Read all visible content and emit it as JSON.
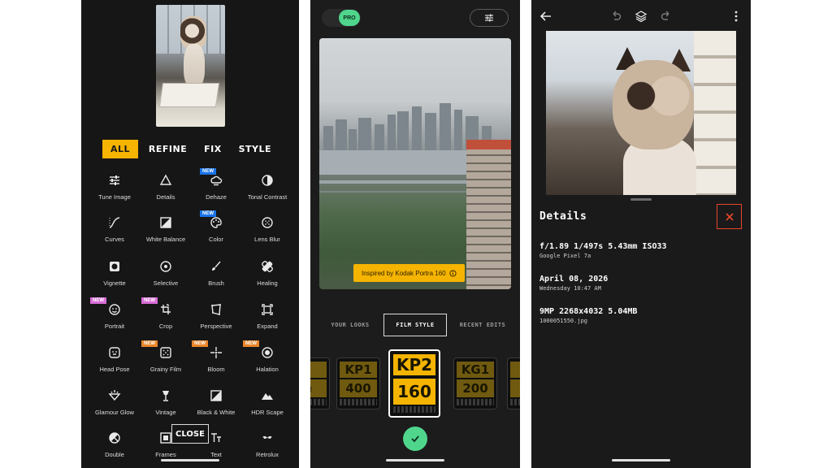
{
  "editor": {
    "tabs": [
      "ALL",
      "REFINE",
      "FIX",
      "STYLE"
    ],
    "active_tab": "ALL",
    "tools": [
      {
        "label": "Tune Image",
        "icon": "sliders-icon"
      },
      {
        "label": "Details",
        "icon": "triangle-icon"
      },
      {
        "label": "Dehaze",
        "icon": "cloud-icon",
        "badge": "NEW"
      },
      {
        "label": "Tonal Contrast",
        "icon": "half-circle-icon"
      },
      {
        "label": "Curves",
        "icon": "curves-icon"
      },
      {
        "label": "White Balance",
        "icon": "white-balance-icon"
      },
      {
        "label": "Color",
        "icon": "palette-icon",
        "badge": "NEW"
      },
      {
        "label": "Lens Blur",
        "icon": "lens-blur-icon"
      },
      {
        "label": "Vignette",
        "icon": "vignette-icon"
      },
      {
        "label": "Selective",
        "icon": "target-icon"
      },
      {
        "label": "Brush",
        "icon": "brush-icon"
      },
      {
        "label": "Healing",
        "icon": "bandage-icon"
      },
      {
        "label": "Portrait",
        "icon": "face-icon",
        "badge": "NEW"
      },
      {
        "label": "Crop",
        "icon": "crop-rotate-icon",
        "badge": "NEW"
      },
      {
        "label": "Perspective",
        "icon": "perspective-icon"
      },
      {
        "label": "Expand",
        "icon": "expand-icon"
      },
      {
        "label": "Head Pose",
        "icon": "head-pose-icon"
      },
      {
        "label": "Grainy Film",
        "icon": "grain-icon",
        "badge": "NEW"
      },
      {
        "label": "Bloom",
        "icon": "sparkle-icon",
        "badge": "NEW"
      },
      {
        "label": "Halation",
        "icon": "halation-icon",
        "badge": "NEW"
      },
      {
        "label": "Glamour Glow",
        "icon": "glow-icon"
      },
      {
        "label": "Vintage",
        "icon": "lamp-icon"
      },
      {
        "label": "Black & White",
        "icon": "bw-icon"
      },
      {
        "label": "HDR Scape",
        "icon": "mountain-icon"
      },
      {
        "label": "Double",
        "icon": "double-exposure-icon"
      },
      {
        "label": "Frames",
        "icon": "frame-icon"
      },
      {
        "label": "Text",
        "icon": "text-icon"
      },
      {
        "label": "Retrolux",
        "icon": "mustache-icon"
      }
    ],
    "close_label": "CLOSE",
    "colors": {
      "accent": "#f5b400",
      "badge_blue": "#1a73e8",
      "badge_pink": "#d86cd6",
      "badge_orange": "#e8862a"
    }
  },
  "film_screen": {
    "pro_label": "PRO",
    "inspired_text": "Inspired by Kodak Portra 160",
    "subtabs": [
      "YOUR LOOKS",
      "FILM STYLE",
      "RECENT EDITS"
    ],
    "active_subtab": "FILM STYLE",
    "films": [
      {
        "code": "",
        "speed": "e"
      },
      {
        "code": "KP1",
        "speed": "400"
      },
      {
        "code": "KP2",
        "speed": "160",
        "selected": true
      },
      {
        "code": "KG1",
        "speed": "200"
      },
      {
        "code": "K",
        "speed": "E"
      }
    ],
    "colors": {
      "pro_green": "#4fd68c",
      "accent": "#f5b400"
    }
  },
  "details_screen": {
    "title": "Details",
    "exif": "f/1.89 1/497s 5.43mm ISO33",
    "device": "Google Pixel 7a",
    "date": "April 08, 2026",
    "time": "Wednesday 10:47 AM",
    "resolution": "9MP 2268x4032 5.04MB",
    "filename": "1000051550.jpg",
    "colors": {
      "close_red": "#e8462a"
    }
  }
}
